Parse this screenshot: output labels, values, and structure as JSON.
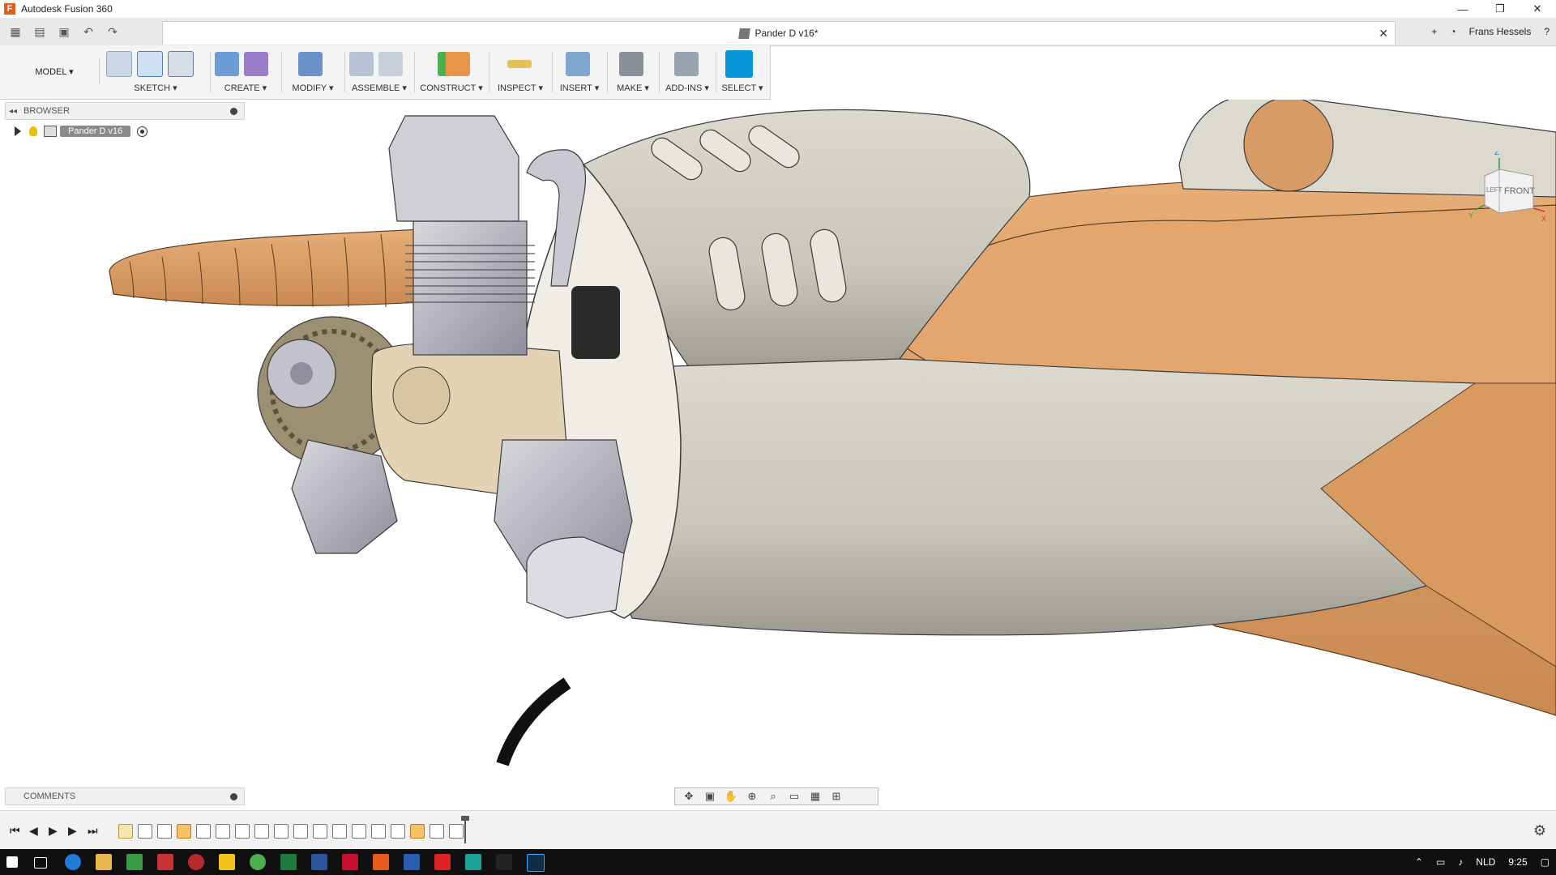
{
  "app": {
    "title": "Autodesk Fusion 360",
    "logo": "F"
  },
  "window": {
    "minimize": "—",
    "restore": "❐",
    "close": "✕"
  },
  "document": {
    "tab_title": "Pander D v16*",
    "close": "✕"
  },
  "quickaccess": {
    "user": "Frans Hessels",
    "help": "?",
    "new_tab": "+"
  },
  "toolbar": {
    "workspace": "MODEL ▾",
    "groups": [
      {
        "label": "SKETCH ▾"
      },
      {
        "label": "CREATE ▾"
      },
      {
        "label": "MODIFY ▾"
      },
      {
        "label": "ASSEMBLE ▾"
      },
      {
        "label": "CONSTRUCT ▾"
      },
      {
        "label": "INSPECT ▾"
      },
      {
        "label": "INSERT ▾"
      },
      {
        "label": "MAKE ▾"
      },
      {
        "label": "ADD-INS ▾"
      },
      {
        "label": "SELECT ▾"
      }
    ]
  },
  "browser": {
    "title": "BROWSER",
    "root": "Pander D v16"
  },
  "comments": {
    "title": "COMMENTS"
  },
  "viewcube": {
    "left": "LEFT",
    "front": "FRONT",
    "z": "Z",
    "x": "X",
    "y": "Y"
  },
  "taskbar": {
    "lang": "NLD",
    "time": "9:25"
  },
  "colors": {
    "accent": "#0696d7",
    "wood": "#e0a46c",
    "metal": "#cfcbc0",
    "engine": "#b9b9c4"
  }
}
